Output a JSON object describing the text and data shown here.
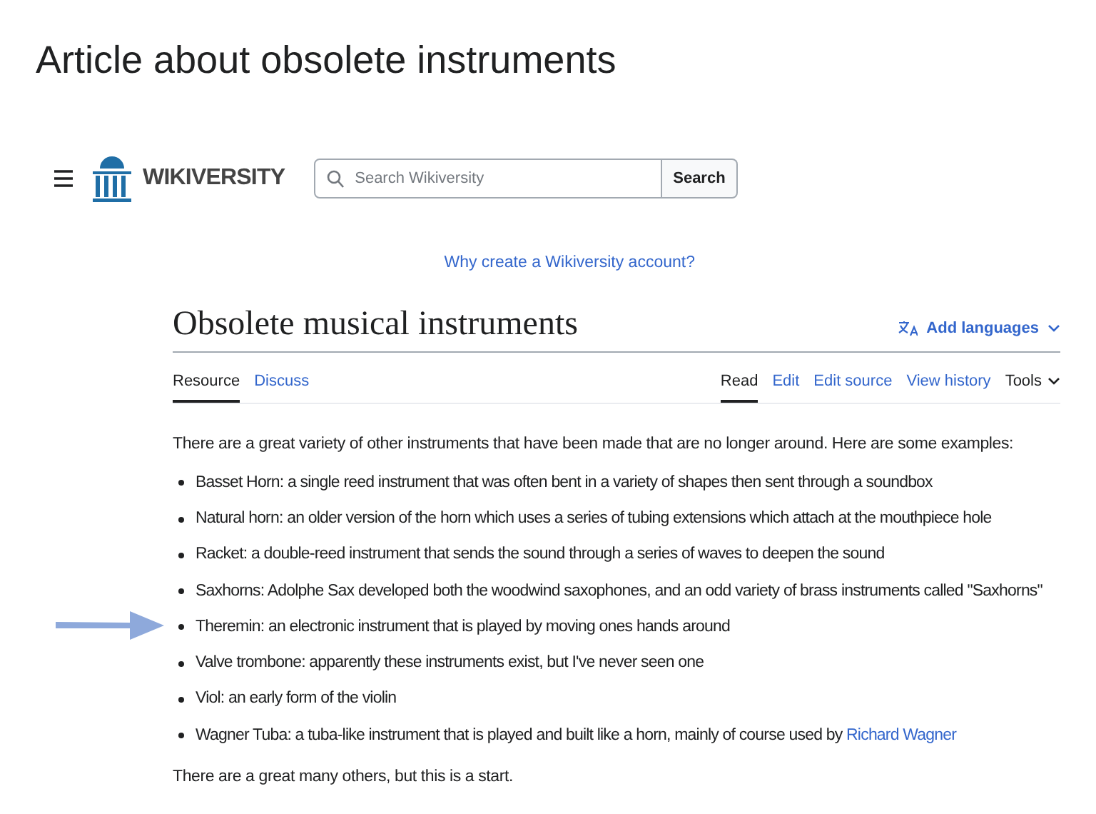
{
  "slide_title": "Article about obsolete instruments",
  "header": {
    "logo_text": "WIKIVERSITY",
    "search": {
      "placeholder": "Search Wikiversity"
    },
    "search_button": "Search",
    "account_link": "Why create a Wikiversity account?"
  },
  "article": {
    "title": "Obsolete musical instruments",
    "add_languages": "Add languages",
    "tabs_left": [
      {
        "label": "Resource",
        "selected": true
      },
      {
        "label": "Discuss",
        "selected": false
      }
    ],
    "tabs_right": [
      {
        "label": "Read",
        "selected": true,
        "kind": "tab"
      },
      {
        "label": "Edit",
        "selected": false,
        "kind": "tab"
      },
      {
        "label": "Edit source",
        "selected": false,
        "kind": "tab"
      },
      {
        "label": "View history",
        "selected": false,
        "kind": "tab"
      },
      {
        "label": "Tools",
        "selected": false,
        "kind": "menu"
      }
    ],
    "intro": "There are a great variety of other instruments that have been made that are no longer around. Here are some examples:",
    "items": [
      {
        "text": "Basset Horn: a single reed instrument that was often bent in a variety of shapes then sent through a soundbox",
        "highlighted": false
      },
      {
        "text": "Natural horn: an older version of the horn which uses a series of tubing extensions which attach at the mouthpiece hole",
        "highlighted": false
      },
      {
        "text": "Racket: a double-reed instrument that sends the sound through a series of waves to deepen the sound",
        "highlighted": false
      },
      {
        "text": "Saxhorns: Adolphe Sax developed both the woodwind saxophones, and an odd variety of brass instruments called \"Saxhorns\"",
        "highlighted": false
      },
      {
        "text": "Theremin: an electronic instrument that is played by moving ones hands around",
        "highlighted": true
      },
      {
        "text": "Valve trombone: apparently these instruments exist, but I've never seen one",
        "highlighted": false
      },
      {
        "text": "Viol: an early form of the violin",
        "highlighted": false
      },
      {
        "text": "Wagner Tuba: a tuba-like instrument that is played and built like a horn, mainly of course used by ",
        "link": "Richard Wagner",
        "highlighted": false
      }
    ],
    "outro": "There are a great many others, but this is a start."
  }
}
